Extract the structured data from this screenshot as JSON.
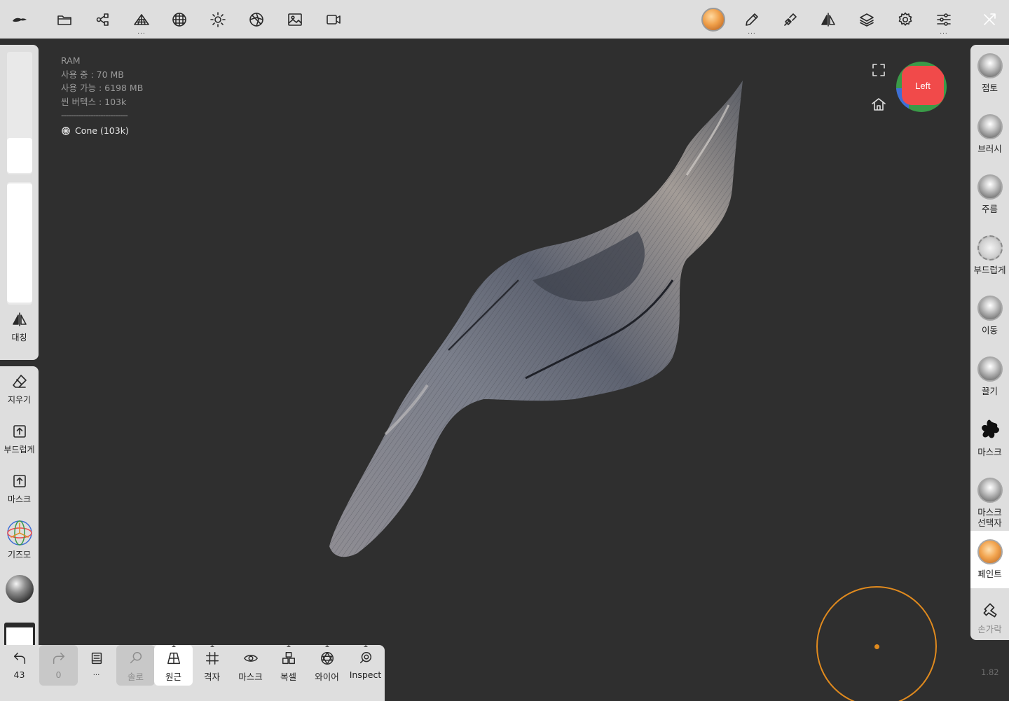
{
  "toolbar": {
    "left_icons": [
      "logo-icon",
      "folder-icon",
      "scene-graph-icon",
      "multires-icon",
      "wireframe-sphere-icon",
      "light-icon",
      "shading-icon",
      "image-icon",
      "camera-icon"
    ],
    "right_icons": [
      "paint-material-icon",
      "pen-icon",
      "stroke-pen-icon",
      "symmetry-icon",
      "layers-icon",
      "settings-icon",
      "sliders-icon",
      "close-panel-icon"
    ],
    "dots": "..."
  },
  "info": {
    "ram_label": "RAM",
    "used": "사용 중 : 70 MB",
    "available": "사용 가능 : 6198 MB",
    "scene_vertices": "씬 버텍스 : 103k",
    "divider": "---------------------------",
    "mesh_name": "Cone (103k)"
  },
  "left_panel": {
    "symmetry_label": "대칭",
    "erase_label": "지우기",
    "smooth_label": "부드럽게",
    "mask_label": "마스크",
    "gizmo_label": "기즈모",
    "slider_size_value": 0.14,
    "slider_intensity_value": 0.6
  },
  "right_panel": {
    "tools": [
      {
        "label": "점토",
        "icon": "clay-brush-icon"
      },
      {
        "label": "브러시",
        "icon": "standard-brush-icon"
      },
      {
        "label": "주름",
        "icon": "crease-brush-icon"
      },
      {
        "label": "부드럽게",
        "icon": "smooth-brush-icon"
      },
      {
        "label": "이동",
        "icon": "move-brush-icon"
      },
      {
        "label": "끌기",
        "icon": "drag-brush-icon"
      },
      {
        "label": "마스크",
        "icon": "mask-brush-icon"
      },
      {
        "label": "마스크\n선택자",
        "icon": "mask-selector-icon"
      },
      {
        "label": "페인트",
        "icon": "paint-brush-icon"
      },
      {
        "label": "손가락",
        "icon": "finger-tool-icon"
      }
    ],
    "active_tool": "페인트"
  },
  "bottom_bar": {
    "undo_count": "43",
    "redo_count": "0",
    "items": [
      {
        "label": "43",
        "icon": "undo-icon"
      },
      {
        "label": "0",
        "icon": "redo-icon"
      },
      {
        "label": "...",
        "icon": "notebook-icon"
      },
      {
        "label": "솔로",
        "icon": "search-icon"
      },
      {
        "label": "원근",
        "icon": "perspective-icon"
      },
      {
        "label": "격자",
        "icon": "grid-icon"
      },
      {
        "label": "마스크",
        "icon": "eye-icon"
      },
      {
        "label": "복셀",
        "icon": "voxel-icon"
      },
      {
        "label": "와이어",
        "icon": "wireframe-icon"
      },
      {
        "label": "Inspect",
        "icon": "inspect-icon"
      }
    ]
  },
  "gizmo": {
    "face_label": "Left"
  },
  "version": "1.82",
  "colors": {
    "accent": "#e08a1e",
    "viewport_bg": "#2f2f2f",
    "panel_bg": "#dedede",
    "cube_red": "#f14a4a",
    "cube_green": "#3a9a48",
    "cube_blue": "#3f6fd6"
  }
}
